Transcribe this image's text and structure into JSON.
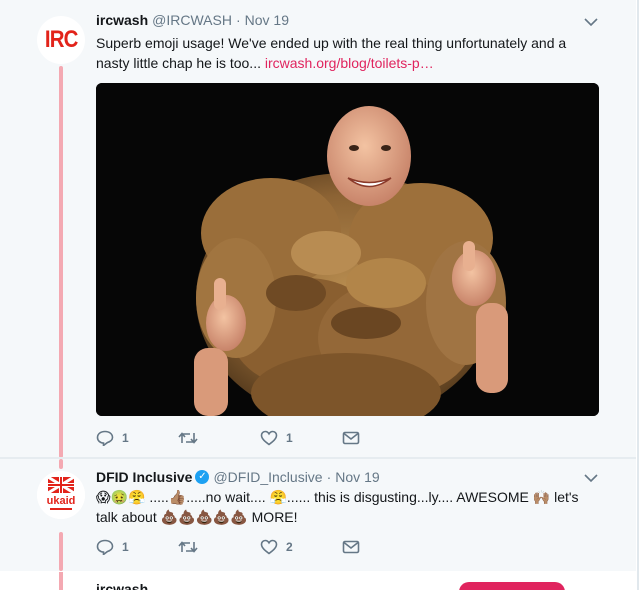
{
  "tweets": [
    {
      "avatar_text": "IRC",
      "name": "ircwash",
      "handle": "@IRCWASH",
      "sep": "·",
      "date": "Nov 19",
      "text": "Superb emoji usage! We've ended up with the real thing unfortunately and a nasty little chap he is too... ",
      "link": "ircwash.org/blog/toilets-p…",
      "replies": "1",
      "retweets": "",
      "likes": "1"
    },
    {
      "avatar_text": "ukaid",
      "name": "DFID Inclusive",
      "handle": "@DFID_Inclusive",
      "sep": "·",
      "date": "Nov 19",
      "text": "😱🤢😤 .....👍🏽.....no wait.... 😤...... this is disgusting...ly.... AWESOME 🙌🏽 let's talk about 💩💩💩💩💩 MORE!",
      "replies": "1",
      "retweets": "",
      "likes": "2"
    }
  ],
  "next_tweet_name": "ircwash",
  "colors": {
    "link": "#e0245e",
    "thread": "#f4a9b2",
    "muted": "#657786",
    "verified": "#1da1f2"
  }
}
